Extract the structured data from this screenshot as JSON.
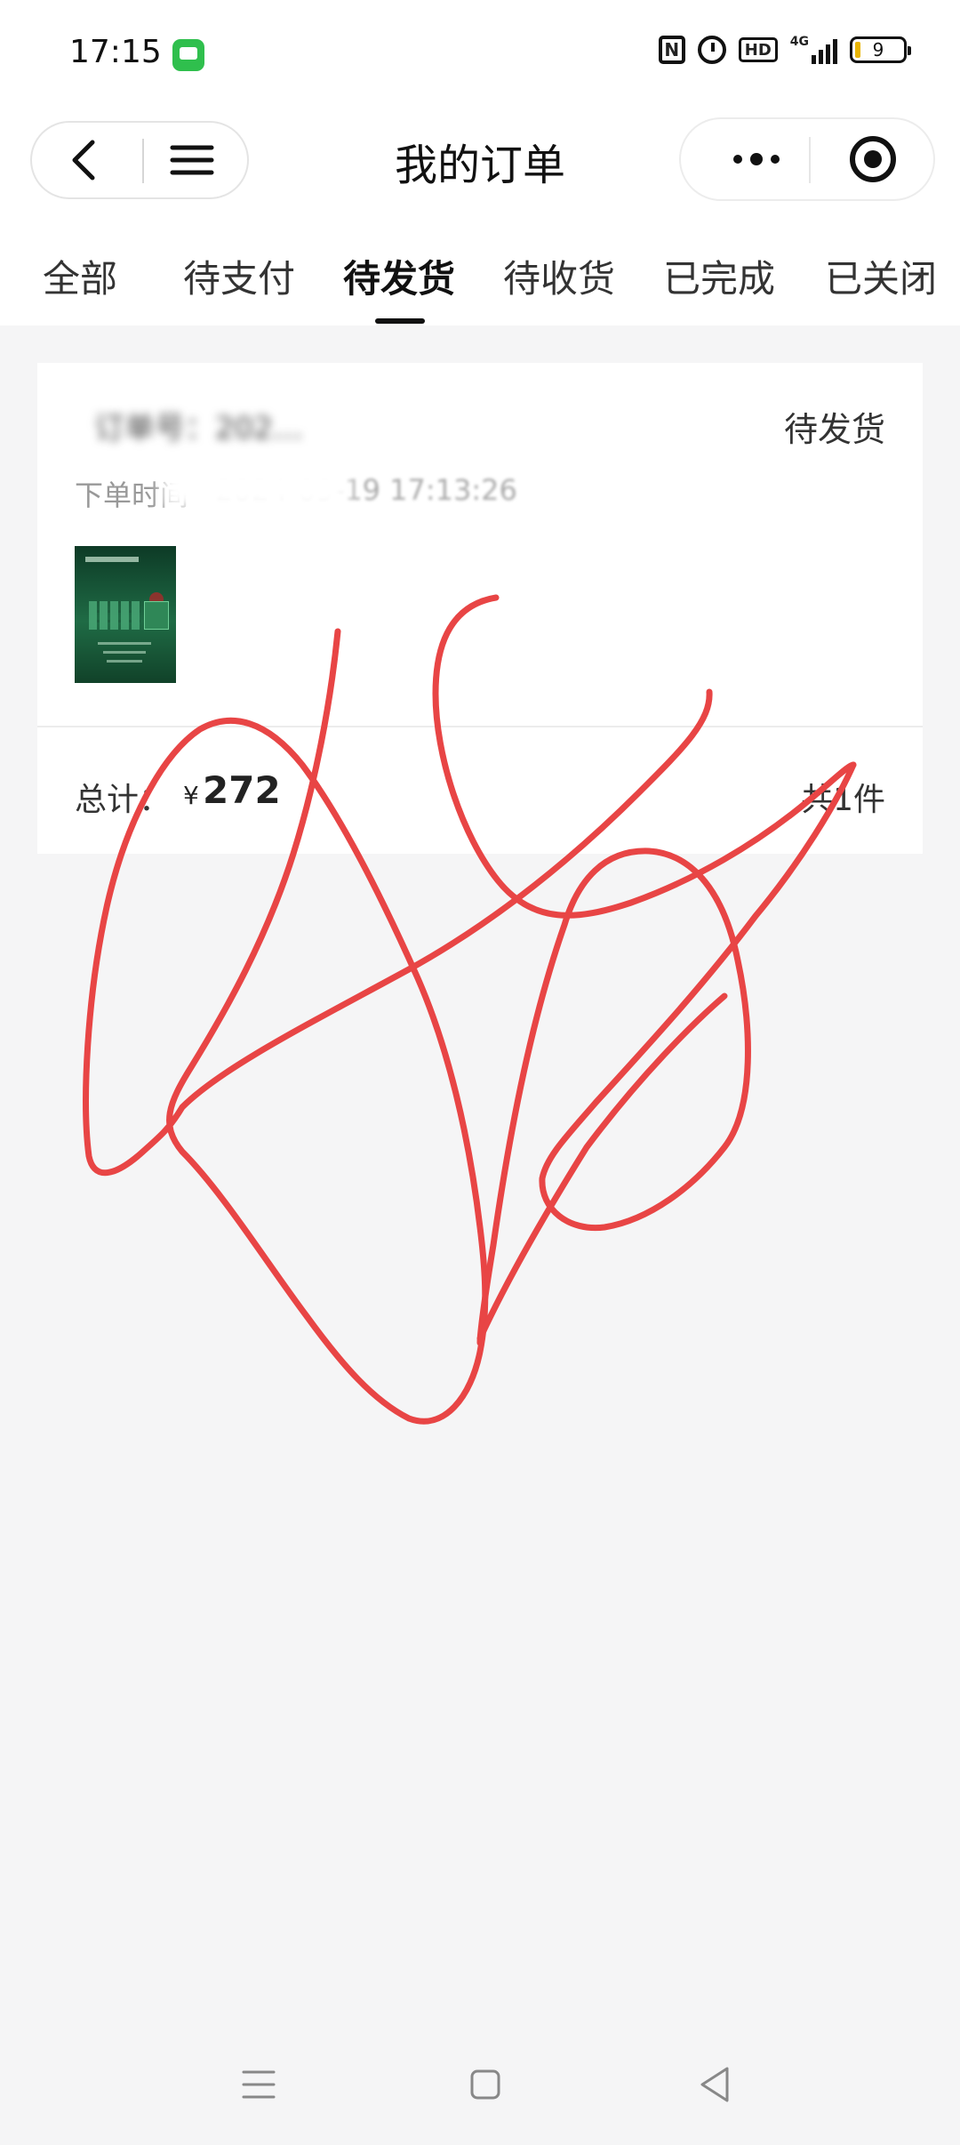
{
  "status_bar": {
    "time": "17:15",
    "icons": [
      "message-app-icon",
      "nfc-icon",
      "alarm-icon",
      "hd-icon",
      "signal-4g-icon",
      "battery-icon"
    ],
    "network_label": "4G",
    "battery_level": "9"
  },
  "nav": {
    "title": "我的订单",
    "left_capsule": [
      "back-icon",
      "menu-icon"
    ],
    "right_capsule": [
      "more-icon",
      "target-icon"
    ]
  },
  "tabs": [
    "全部",
    "待支付",
    "待发货",
    "待收货",
    "已完成",
    "已关闭"
  ],
  "active_tab": "待发货",
  "order": {
    "number_text": "订单号：202…",
    "status": "待发货",
    "time_label": "下单时间",
    "time_value": "2024-09-19 17:13:26",
    "total_label": "总计：",
    "currency": "¥",
    "total": "272",
    "item_count": "共1件"
  },
  "overlay": {
    "stroke_color": "#e84545",
    "description_icon": "handwritten-scribble"
  },
  "colors": {
    "background": "#f5f5f6",
    "card": "#ffffff",
    "scribble": "#e84545",
    "message_icon": "#2fbf4d"
  },
  "system_nav": [
    "recent-apps-icon",
    "home-icon",
    "back-triangle-icon"
  ]
}
